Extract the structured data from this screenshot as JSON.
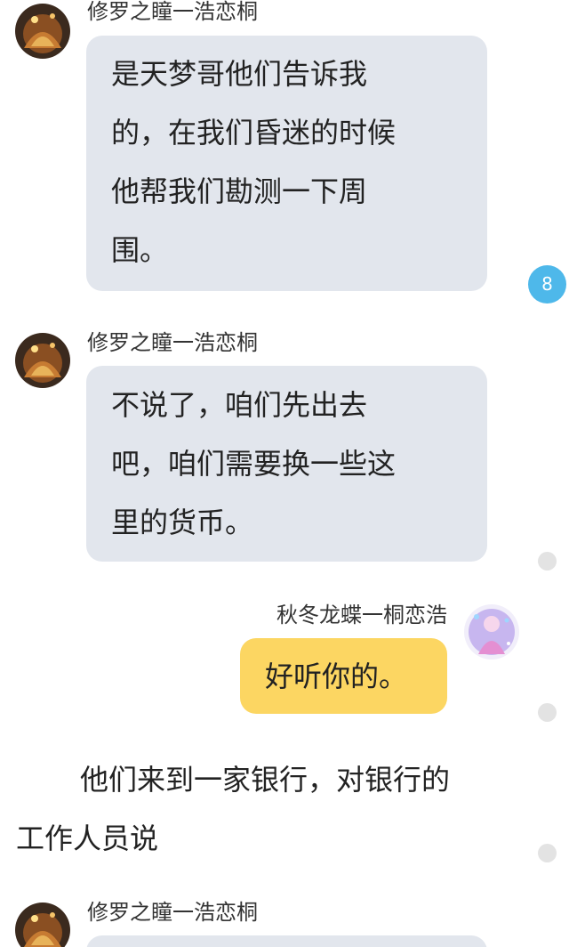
{
  "messages": [
    {
      "sender": "修罗之瞳一浩恋桐",
      "lines": [
        "是天梦哥他们告诉我",
        "的，在我们昏迷的时候",
        "他帮我们勘测一下周",
        "围。"
      ]
    },
    {
      "sender": "修罗之瞳一浩恋桐",
      "lines": [
        "不说了，咱们先出去",
        "吧，咱们需要换一些这",
        "里的货币。"
      ]
    },
    {
      "sender": "秋冬龙蝶一桐恋浩",
      "lines": [
        "好听你的。"
      ]
    },
    {
      "sender": "修罗之瞳一浩恋桐",
      "lines": []
    }
  ],
  "narration": {
    "line1": "他们来到一家银行，对银行的",
    "line2": "工作人员说"
  },
  "badge": {
    "count": "8",
    "color": "#4eb8ea"
  },
  "colors": {
    "left_bubble": "#e2e6ed",
    "right_bubble": "#fcd662"
  }
}
